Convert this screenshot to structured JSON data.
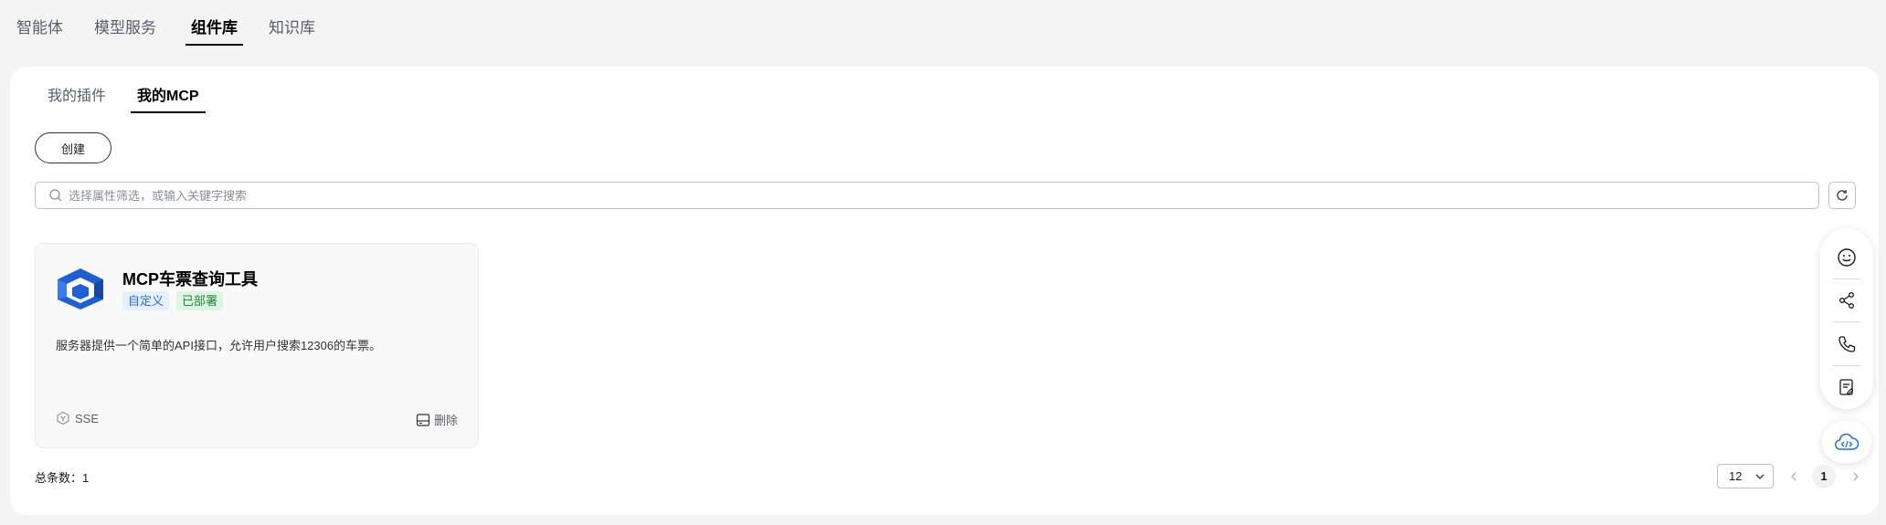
{
  "top_tabs": [
    {
      "label": "智能体"
    },
    {
      "label": "模型服务"
    },
    {
      "label": "组件库"
    },
    {
      "label": "知识库"
    }
  ],
  "sub_tabs": [
    {
      "label": "我的插件"
    },
    {
      "label": "我的MCP"
    }
  ],
  "create_label": "创建",
  "search": {
    "placeholder": "选择属性筛选，或输入关键字搜索",
    "value": ""
  },
  "card": {
    "title": "MCP车票查询工具",
    "tags": [
      "自定义",
      "已部署"
    ],
    "description": "服务器提供一个简单的API接口，允许用户搜索12306的车票。",
    "protocol": "SSE",
    "delete_label": "删除"
  },
  "total_label": "总条数：",
  "total_count": "1",
  "pagination": {
    "page_size": "12",
    "current_page": "1"
  },
  "colors": {
    "accent_blue": "#1f5fd6",
    "tag_blue": "#2a6be0",
    "tag_green": "#1f8a3a"
  }
}
